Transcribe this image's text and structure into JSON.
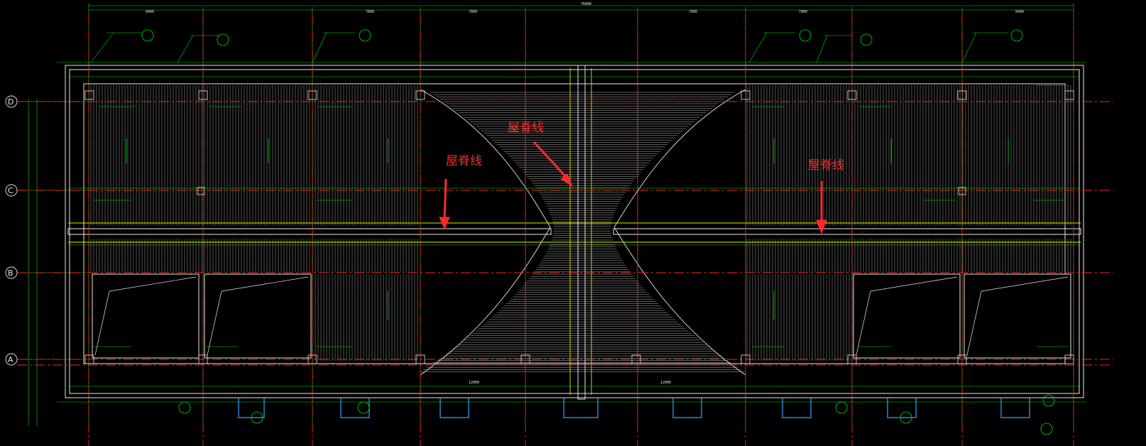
{
  "drawing": {
    "top_overall_dimension": "76800",
    "top_dimensions": [
      "8400",
      "7800",
      "7800",
      "7800",
      "7800",
      "8400"
    ],
    "sub_dimensions": [
      "12000",
      "12000"
    ],
    "axis_labels": [
      "D",
      "C",
      "B",
      "A"
    ],
    "annotations": {
      "ridge_line": "屋脊线"
    },
    "colors": {
      "background": "#000000",
      "frame": "#e8e8e8",
      "grid_axis": "#ff2020",
      "dimension": "#00ff00",
      "hatch": "#cfcfcf",
      "ridge_band": "#e8e800",
      "drain": "#2aa8ff",
      "callout": "#ff2a2a"
    }
  }
}
